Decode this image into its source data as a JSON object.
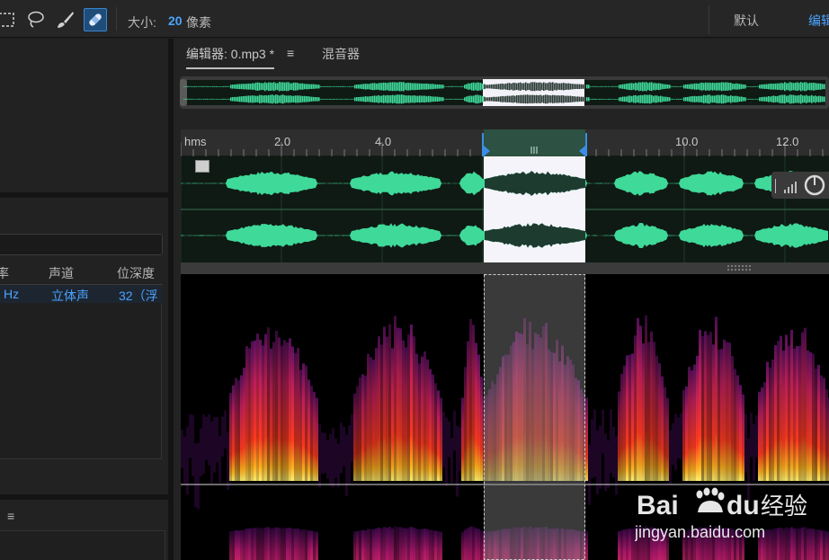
{
  "toolbar": {
    "tools": [
      {
        "name": "rectangular-marquee",
        "icon": "marquee-icon"
      },
      {
        "name": "lasso",
        "icon": "lasso-icon"
      },
      {
        "name": "paintbrush",
        "icon": "brush-icon"
      },
      {
        "name": "spot-healing",
        "icon": "healing-brush-icon",
        "active": true
      }
    ],
    "size_label": "大小:",
    "size_value": "20",
    "size_unit": "像素",
    "workspace_default": "默认",
    "workspace_edit": "编辑"
  },
  "files_panel": {
    "columns": [
      "率",
      "声道",
      "位深度"
    ],
    "rows": [
      {
        "rate": "Hz",
        "channel": "立体声",
        "depth": "32（浮"
      }
    ]
  },
  "bottom_panel": {
    "menu_icon": "≡"
  },
  "editor": {
    "tab_editor": "编辑器: 0.mp3 *",
    "tab_menu": "≡",
    "tab_mixer": "混音器",
    "ruler_labels": [
      "hms",
      "2.0",
      "4.0",
      "10.0",
      "12.0"
    ],
    "selection": {
      "start_fraction": 0.465,
      "end_fraction": 0.62
    }
  },
  "watermark": {
    "brand": "Bai",
    "brand2": "du",
    "product": "经验",
    "url": "jingyan.baidu.com"
  },
  "colors": {
    "accent": "#4aa3ff",
    "waveform": "#3fd99a",
    "selection_marker": "#3a8ee6"
  }
}
